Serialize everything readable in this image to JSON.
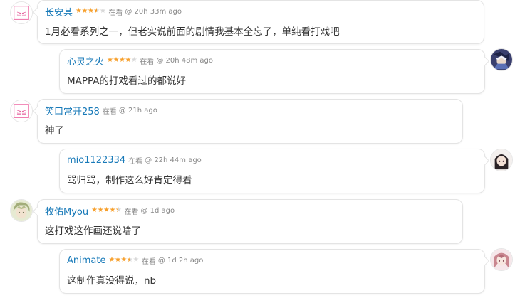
{
  "comments": [
    {
      "user": "长安某",
      "stars": [
        1,
        1,
        1,
        0.5,
        0
      ],
      "status": "在看",
      "time": "@ 20h 33m ago",
      "text": "1月必看系列之一，但老实说前面的剧情我基本全忘了，单纯看打戏吧",
      "avatar": "kaomoji-avatar-icon"
    },
    {
      "user": "心灵之火",
      "stars": [
        1,
        1,
        1,
        1,
        0
      ],
      "status": "在看",
      "time": "@ 20h 48m ago",
      "text": "MAPPA的打戏看过的都说好",
      "avatar": "anime-avatar-icon"
    },
    {
      "user": "笑口常开258",
      "stars": [],
      "status": "在看",
      "time": "@ 21h ago",
      "text": "神了",
      "avatar": "kaomoji-avatar-icon"
    },
    {
      "user": "mio1122334",
      "stars": [],
      "status": "在看",
      "time": "@ 22h 44m ago",
      "text": "骂归骂，制作这么好肯定得看",
      "avatar": "anime-girl-avatar-icon"
    },
    {
      "user": "牧佑Myou",
      "stars": [
        1,
        1,
        1,
        1,
        0.5
      ],
      "status": "在看",
      "time": "@ 1d ago",
      "text": "这打戏这作画还说啥了",
      "avatar": "anime-boy-avatar-icon"
    },
    {
      "user": "Animate",
      "stars": [
        1,
        1,
        1,
        0.5,
        0
      ],
      "status": "在看",
      "time": "@ 1d 2h ago",
      "text": "这制作真没得说，nb",
      "avatar": "anime-pink-avatar-icon"
    }
  ]
}
